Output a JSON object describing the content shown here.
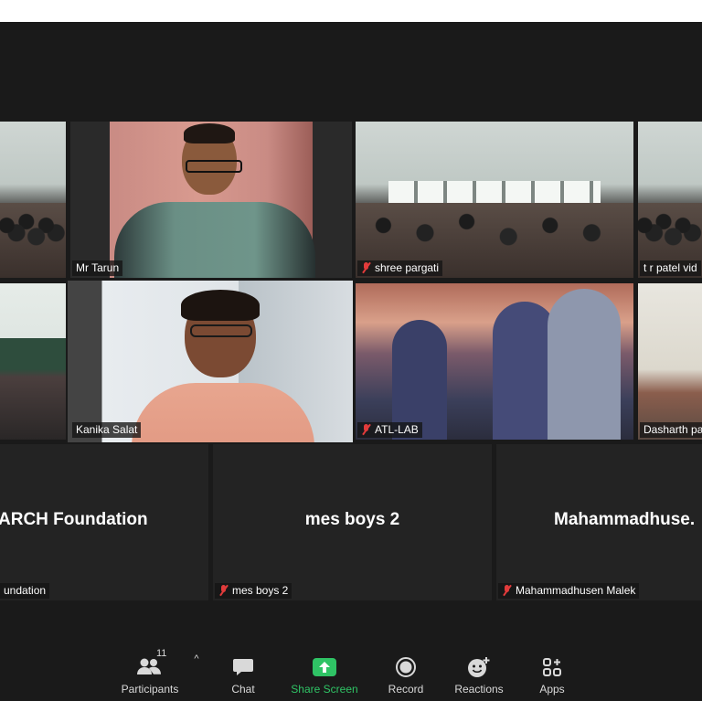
{
  "participants_tiles": [
    {
      "name": "Mr Tarun",
      "muted": false
    },
    {
      "name": "shree pargati",
      "muted": true
    },
    {
      "name": "t r patel vid",
      "muted": false
    },
    {
      "name": "Kanika Salat",
      "muted": false
    },
    {
      "name": "ATL-LAB",
      "muted": true
    },
    {
      "name": "Dasharth pa",
      "muted": false
    },
    {
      "name": "undation",
      "display": "ARCH Foundation",
      "muted": false
    },
    {
      "name": "mes boys 2",
      "display": "mes boys 2",
      "muted": true
    },
    {
      "name": "Mahammadhusen Malek",
      "display": "Mahammadhuse.",
      "muted": true
    }
  ],
  "toolbar": {
    "participants_label": "Participants",
    "participants_count": "11",
    "caret": "^",
    "chat_label": "Chat",
    "share_label": "Share Screen",
    "record_label": "Record",
    "reactions_label": "Reactions",
    "apps_label": "Apps"
  },
  "colors": {
    "background": "#1a1a1a",
    "active_speaker_border": "#e9e57c",
    "share_green": "#2fc365",
    "muted_red": "#e23b3b"
  },
  "icons": [
    "participants-icon",
    "chat-icon",
    "share-screen-icon",
    "record-icon",
    "reactions-icon",
    "apps-icon",
    "muted-mic-icon"
  ]
}
